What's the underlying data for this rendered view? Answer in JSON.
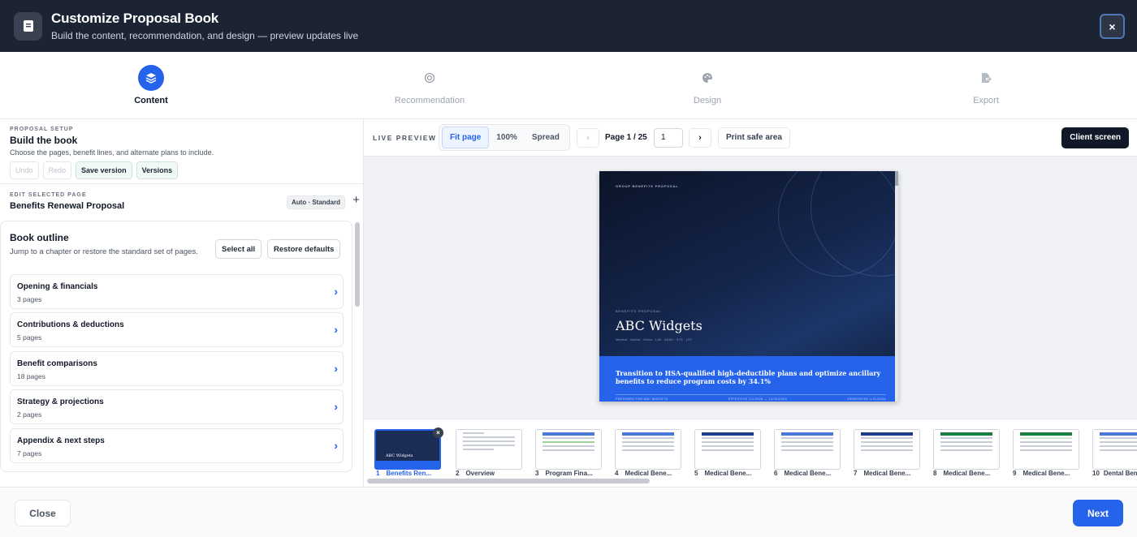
{
  "header": {
    "title": "Customize Proposal Book",
    "subtitle": "Build the content, recommendation, and design — preview updates live",
    "close_label": "×"
  },
  "steps": [
    {
      "label": "Content",
      "icon": "layers-icon",
      "active": true
    },
    {
      "label": "Recommendation",
      "icon": "target-icon",
      "active": false
    },
    {
      "label": "Design",
      "icon": "palette-icon",
      "active": false
    },
    {
      "label": "Export",
      "icon": "file-export-icon",
      "active": false
    }
  ],
  "setup": {
    "eyebrow": "PROPOSAL SETUP",
    "title": "Build the book",
    "description": "Choose the pages, benefit lines, and alternate plans to include.",
    "undo": "Undo",
    "redo": "Redo",
    "save_version": "Save version",
    "versions": "Versions"
  },
  "edit_page": {
    "eyebrow": "EDIT SELECTED PAGE",
    "title": "Benefits Renewal Proposal",
    "badge": "Auto · Standard",
    "add_label": "+"
  },
  "outline": {
    "title": "Book outline",
    "description": "Jump to a chapter or restore the standard set of pages.",
    "select_all": "Select all",
    "restore_defaults": "Restore defaults",
    "chapters": [
      {
        "title": "Opening & financials",
        "pages": "3 pages"
      },
      {
        "title": "Contributions & deductions",
        "pages": "5 pages"
      },
      {
        "title": "Benefit comparisons",
        "pages": "18 pages"
      },
      {
        "title": "Strategy & projections",
        "pages": "2 pages"
      },
      {
        "title": "Appendix & next steps",
        "pages": "7 pages"
      }
    ]
  },
  "preview": {
    "label": "LIVE PREVIEW",
    "zoom_options": [
      "Fit page",
      "100%",
      "Spread"
    ],
    "zoom_selected": "Fit page",
    "prev": "‹",
    "next": "›",
    "page_count": "Page 1 / 25",
    "page_input": "1",
    "print_safe": "Print safe area",
    "client_screen": "Client screen"
  },
  "cover_page": {
    "eyebrow": "GROUP BENEFITS PROPOSAL",
    "small_label": "BENEFITS PROPOSAL",
    "company": "ABC Widgets",
    "lines": "Medical · Dental · Vision · Life · AD&D · STD · LTD",
    "headline": "Transition to HSA-qualified high-deductible plans and optimize ancillary benefits to reduce program costs by 34.1%",
    "footer_left": "PREPARED FOR ABC WIDGETS",
    "footer_mid": "EFFECTIVE 1/1/2026 — 12/31/2026",
    "footer_right": "GENERATED 1/31/2026"
  },
  "thumbnails": [
    {
      "num": "1",
      "label": "Benefits Ren...",
      "selected": true
    },
    {
      "num": "2",
      "label": "Overview",
      "selected": false
    },
    {
      "num": "3",
      "label": "Program Fina...",
      "selected": false
    },
    {
      "num": "4",
      "label": "Medical Bene...",
      "selected": false
    },
    {
      "num": "5",
      "label": "Medical Bene...",
      "selected": false
    },
    {
      "num": "6",
      "label": "Medical Bene...",
      "selected": false
    },
    {
      "num": "7",
      "label": "Medical Bene...",
      "selected": false
    },
    {
      "num": "8",
      "label": "Medical Bene...",
      "selected": false
    },
    {
      "num": "9",
      "label": "Medical Bene...",
      "selected": false
    },
    {
      "num": "10",
      "label": "Dental Bene...",
      "selected": false
    }
  ],
  "footer": {
    "close": "Close",
    "next": "Next"
  },
  "colors": {
    "header_bg": "#1c2434",
    "accent": "#2563eb",
    "client_btn": "#111827"
  }
}
